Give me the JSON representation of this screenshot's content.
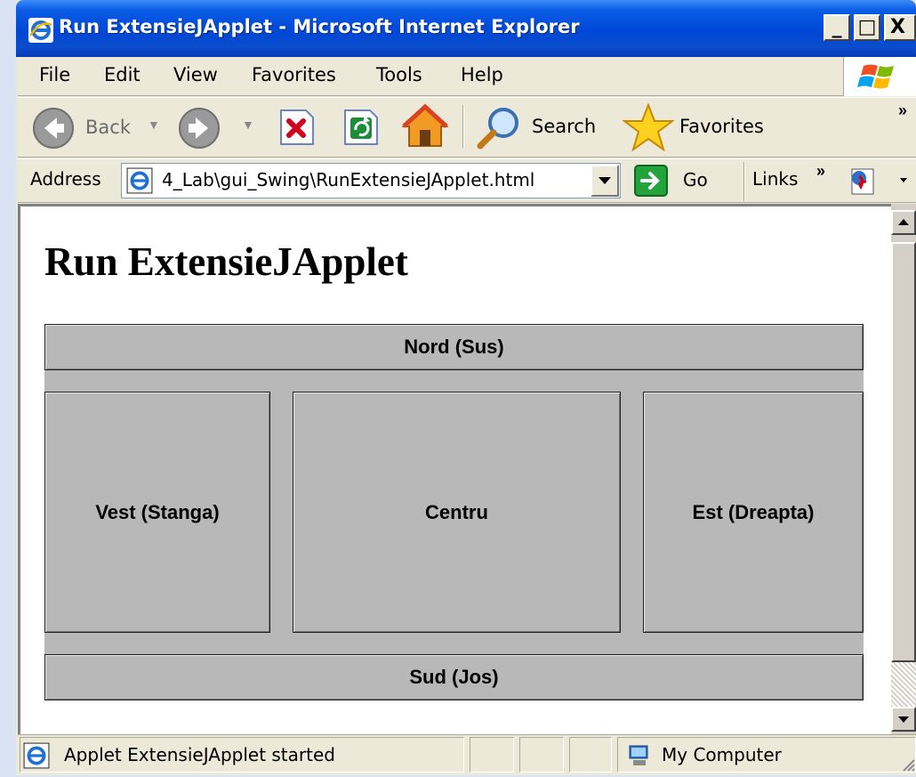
{
  "window": {
    "title": "Run ExtensieJApplet - Microsoft Internet Explorer",
    "controls": {
      "minimize": "_",
      "maximize": "□",
      "close": "X"
    }
  },
  "menu": {
    "items": [
      {
        "label": "File"
      },
      {
        "label": "Edit"
      },
      {
        "label": "View"
      },
      {
        "label": "Favorites"
      },
      {
        "label": "Tools"
      },
      {
        "label": "Help"
      }
    ]
  },
  "toolbar": {
    "back_label": "Back",
    "search_label": "Search",
    "favorites_label": "Favorites",
    "overflow": "»"
  },
  "address": {
    "label": "Address",
    "value": "4_Lab\\gui_Swing\\RunExtensieJApplet.html",
    "go_label": "Go",
    "links_label": "Links",
    "links_overflow": "»"
  },
  "page": {
    "heading": "Run ExtensieJApplet",
    "applet": {
      "north": "Nord (Sus)",
      "west": "Vest (Stanga)",
      "center": "Centru",
      "east": "Est (Dreapta)",
      "south": "Sud (Jos)"
    }
  },
  "status": {
    "message": "Applet ExtensieJApplet started",
    "zone": "My Computer"
  },
  "colors": {
    "title_bar": "#0047d6",
    "applet_bg": "#b8b8b8",
    "chrome": "#ece9d8"
  }
}
